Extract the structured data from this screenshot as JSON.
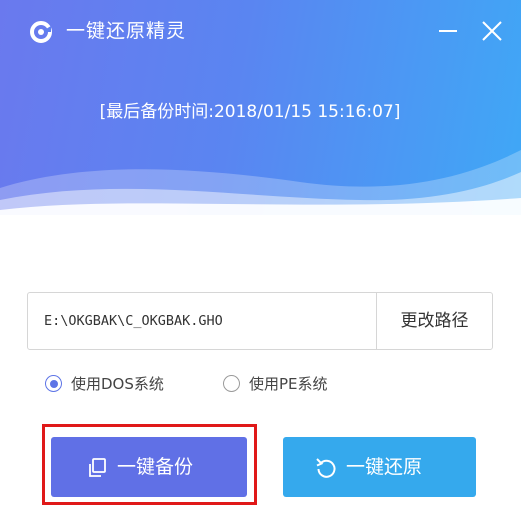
{
  "app": {
    "title": "一键还原精灵"
  },
  "window_controls": {
    "minimize_icon": "minimize-icon",
    "close_icon": "close-icon"
  },
  "status": {
    "last_backup_text": "[最后备份时间:2018/01/15 15:16:07]"
  },
  "path": {
    "value": "E:\\OKGBAK\\C_OKGBAK.GHO",
    "change_label": "更改路径"
  },
  "mode": {
    "options": [
      {
        "label": "使用DOS系统",
        "selected": true
      },
      {
        "label": "使用PE系统",
        "selected": false
      }
    ]
  },
  "actions": {
    "backup_label": "一键备份",
    "backup_icon": "copy-icon",
    "restore_label": "一键还原",
    "restore_icon": "undo-icon"
  },
  "colors": {
    "header_start": "#6a79ee",
    "header_end": "#3fa8f6",
    "backup_button": "#6070e6",
    "restore_button": "#35a9ed",
    "highlight": "#e01818",
    "radio_accent": "#5d74e6"
  }
}
